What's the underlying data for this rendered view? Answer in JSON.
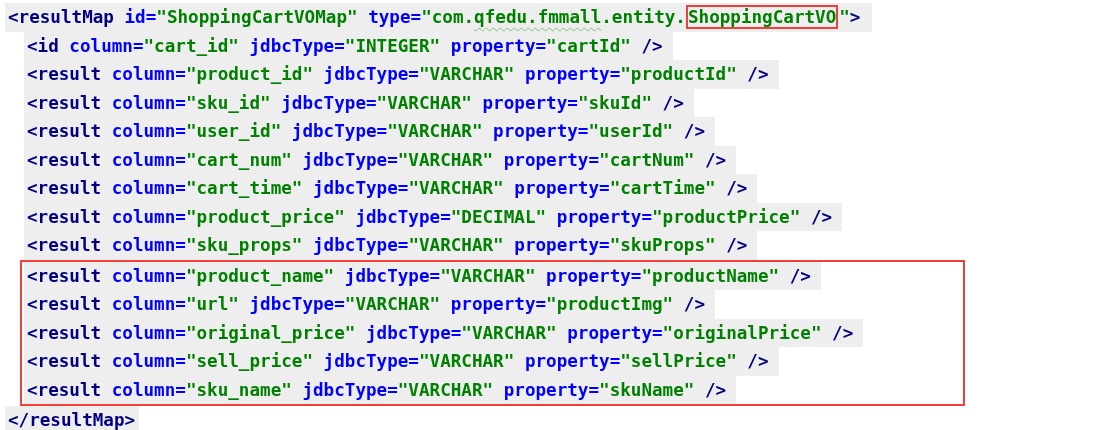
{
  "result_map": {
    "open_tag": [
      {
        "kind": "tag",
        "text": "<resultMap"
      },
      {
        "kind": "attr",
        "text": " id="
      },
      {
        "kind": "value",
        "text": "\"ShoppingCartVOMap\""
      },
      {
        "kind": "attr",
        "text": " type="
      },
      {
        "kind": "value",
        "text": "\"com."
      },
      {
        "kind": "misspelled",
        "text": "qfedu.fmmall"
      },
      {
        "kind": "value",
        "text": ".entity."
      },
      {
        "kind": "boxed",
        "text": "ShoppingCartVO"
      },
      {
        "kind": "value",
        "text": "\""
      },
      {
        "kind": "tag",
        "text": ">"
      }
    ],
    "children": [
      {
        "boxed": false,
        "segments": [
          {
            "kind": "tag",
            "text": "<id"
          },
          {
            "kind": "attr",
            "text": " column="
          },
          {
            "kind": "value",
            "text": "\"cart_id\""
          },
          {
            "kind": "attr",
            "text": " jdbcType="
          },
          {
            "kind": "value",
            "text": "\"INTEGER\""
          },
          {
            "kind": "attr",
            "text": " property="
          },
          {
            "kind": "value",
            "text": "\"cartId\""
          },
          {
            "kind": "tag",
            "text": " />"
          }
        ]
      },
      {
        "boxed": false,
        "segments": [
          {
            "kind": "tag",
            "text": "<result"
          },
          {
            "kind": "attr",
            "text": " column="
          },
          {
            "kind": "value",
            "text": "\"product_id\""
          },
          {
            "kind": "attr",
            "text": " jdbcType="
          },
          {
            "kind": "value",
            "text": "\"VARCHAR\""
          },
          {
            "kind": "attr",
            "text": " property="
          },
          {
            "kind": "value",
            "text": "\"productId\""
          },
          {
            "kind": "tag",
            "text": " />"
          }
        ]
      },
      {
        "boxed": false,
        "segments": [
          {
            "kind": "tag",
            "text": "<result"
          },
          {
            "kind": "attr",
            "text": " column="
          },
          {
            "kind": "value",
            "text": "\"sku_id\""
          },
          {
            "kind": "attr",
            "text": " jdbcType="
          },
          {
            "kind": "value",
            "text": "\"VARCHAR\""
          },
          {
            "kind": "attr",
            "text": " property="
          },
          {
            "kind": "value",
            "text": "\"skuId\""
          },
          {
            "kind": "tag",
            "text": " />"
          }
        ]
      },
      {
        "boxed": false,
        "segments": [
          {
            "kind": "tag",
            "text": "<result"
          },
          {
            "kind": "attr",
            "text": " column="
          },
          {
            "kind": "value",
            "text": "\"user_id\""
          },
          {
            "kind": "attr",
            "text": " jdbcType="
          },
          {
            "kind": "value",
            "text": "\"VARCHAR\""
          },
          {
            "kind": "attr",
            "text": " property="
          },
          {
            "kind": "value",
            "text": "\"userId\""
          },
          {
            "kind": "tag",
            "text": " />"
          }
        ]
      },
      {
        "boxed": false,
        "segments": [
          {
            "kind": "tag",
            "text": "<result"
          },
          {
            "kind": "attr",
            "text": " column="
          },
          {
            "kind": "value",
            "text": "\"cart_num\""
          },
          {
            "kind": "attr",
            "text": " jdbcType="
          },
          {
            "kind": "value",
            "text": "\"VARCHAR\""
          },
          {
            "kind": "attr",
            "text": " property="
          },
          {
            "kind": "value",
            "text": "\"cartNum\""
          },
          {
            "kind": "tag",
            "text": " />"
          }
        ]
      },
      {
        "boxed": false,
        "segments": [
          {
            "kind": "tag",
            "text": "<result"
          },
          {
            "kind": "attr",
            "text": " column="
          },
          {
            "kind": "value",
            "text": "\"cart_time\""
          },
          {
            "kind": "attr",
            "text": " jdbcType="
          },
          {
            "kind": "value",
            "text": "\"VARCHAR\""
          },
          {
            "kind": "attr",
            "text": " property="
          },
          {
            "kind": "value",
            "text": "\"cartTime\""
          },
          {
            "kind": "tag",
            "text": " />"
          }
        ]
      },
      {
        "boxed": false,
        "segments": [
          {
            "kind": "tag",
            "text": "<result"
          },
          {
            "kind": "attr",
            "text": " column="
          },
          {
            "kind": "value",
            "text": "\"product_price\""
          },
          {
            "kind": "attr",
            "text": " jdbcType="
          },
          {
            "kind": "value",
            "text": "\"DECIMAL\""
          },
          {
            "kind": "attr",
            "text": " property="
          },
          {
            "kind": "value",
            "text": "\"productPrice\""
          },
          {
            "kind": "tag",
            "text": " />"
          }
        ]
      },
      {
        "boxed": false,
        "segments": [
          {
            "kind": "tag",
            "text": "<result"
          },
          {
            "kind": "attr",
            "text": " column="
          },
          {
            "kind": "value",
            "text": "\"sku_props\""
          },
          {
            "kind": "attr",
            "text": " jdbcType="
          },
          {
            "kind": "value",
            "text": "\"VARCHAR\""
          },
          {
            "kind": "attr",
            "text": " property="
          },
          {
            "kind": "value",
            "text": "\"skuProps\""
          },
          {
            "kind": "tag",
            "text": " />"
          }
        ]
      },
      {
        "boxed": true,
        "segments": [
          {
            "kind": "tag",
            "text": "<result"
          },
          {
            "kind": "attr",
            "text": " column="
          },
          {
            "kind": "value",
            "text": "\"product_name\""
          },
          {
            "kind": "attr",
            "text": " jdbcType="
          },
          {
            "kind": "value",
            "text": "\"VARCHAR\""
          },
          {
            "kind": "attr",
            "text": " property="
          },
          {
            "kind": "value",
            "text": "\"productName\""
          },
          {
            "kind": "tag",
            "text": " />"
          }
        ]
      },
      {
        "boxed": true,
        "segments": [
          {
            "kind": "tag",
            "text": "<result"
          },
          {
            "kind": "attr",
            "text": " column="
          },
          {
            "kind": "value",
            "text": "\"url\""
          },
          {
            "kind": "attr",
            "text": " jdbcType="
          },
          {
            "kind": "value",
            "text": "\"VARCHAR\""
          },
          {
            "kind": "attr",
            "text": " property="
          },
          {
            "kind": "value",
            "text": "\"productImg\""
          },
          {
            "kind": "tag",
            "text": " />"
          }
        ]
      },
      {
        "boxed": true,
        "segments": [
          {
            "kind": "tag",
            "text": "<result"
          },
          {
            "kind": "attr",
            "text": " column="
          },
          {
            "kind": "value",
            "text": "\"original_price\""
          },
          {
            "kind": "attr",
            "text": " jdbcType="
          },
          {
            "kind": "value",
            "text": "\"VARCHAR\""
          },
          {
            "kind": "attr",
            "text": " property="
          },
          {
            "kind": "value",
            "text": "\"originalPrice\""
          },
          {
            "kind": "tag",
            "text": " />"
          }
        ]
      },
      {
        "boxed": true,
        "segments": [
          {
            "kind": "tag",
            "text": "<result"
          },
          {
            "kind": "attr",
            "text": " column="
          },
          {
            "kind": "value",
            "text": "\"sell_price\""
          },
          {
            "kind": "attr",
            "text": " jdbcType="
          },
          {
            "kind": "value",
            "text": "\"VARCHAR\""
          },
          {
            "kind": "attr",
            "text": " property="
          },
          {
            "kind": "value",
            "text": "\"sellPrice\""
          },
          {
            "kind": "tag",
            "text": " />"
          }
        ]
      },
      {
        "boxed": true,
        "segments": [
          {
            "kind": "tag",
            "text": "<result"
          },
          {
            "kind": "attr",
            "text": " column="
          },
          {
            "kind": "value",
            "text": "\"sku_name\""
          },
          {
            "kind": "attr",
            "text": " jdbcType="
          },
          {
            "kind": "value",
            "text": "\"VARCHAR\""
          },
          {
            "kind": "attr",
            "text": " property="
          },
          {
            "kind": "value",
            "text": "\"skuName\""
          },
          {
            "kind": "tag",
            "text": " />"
          }
        ]
      }
    ],
    "close_tag": [
      {
        "kind": "tag",
        "text": "</resultMap>"
      }
    ]
  }
}
